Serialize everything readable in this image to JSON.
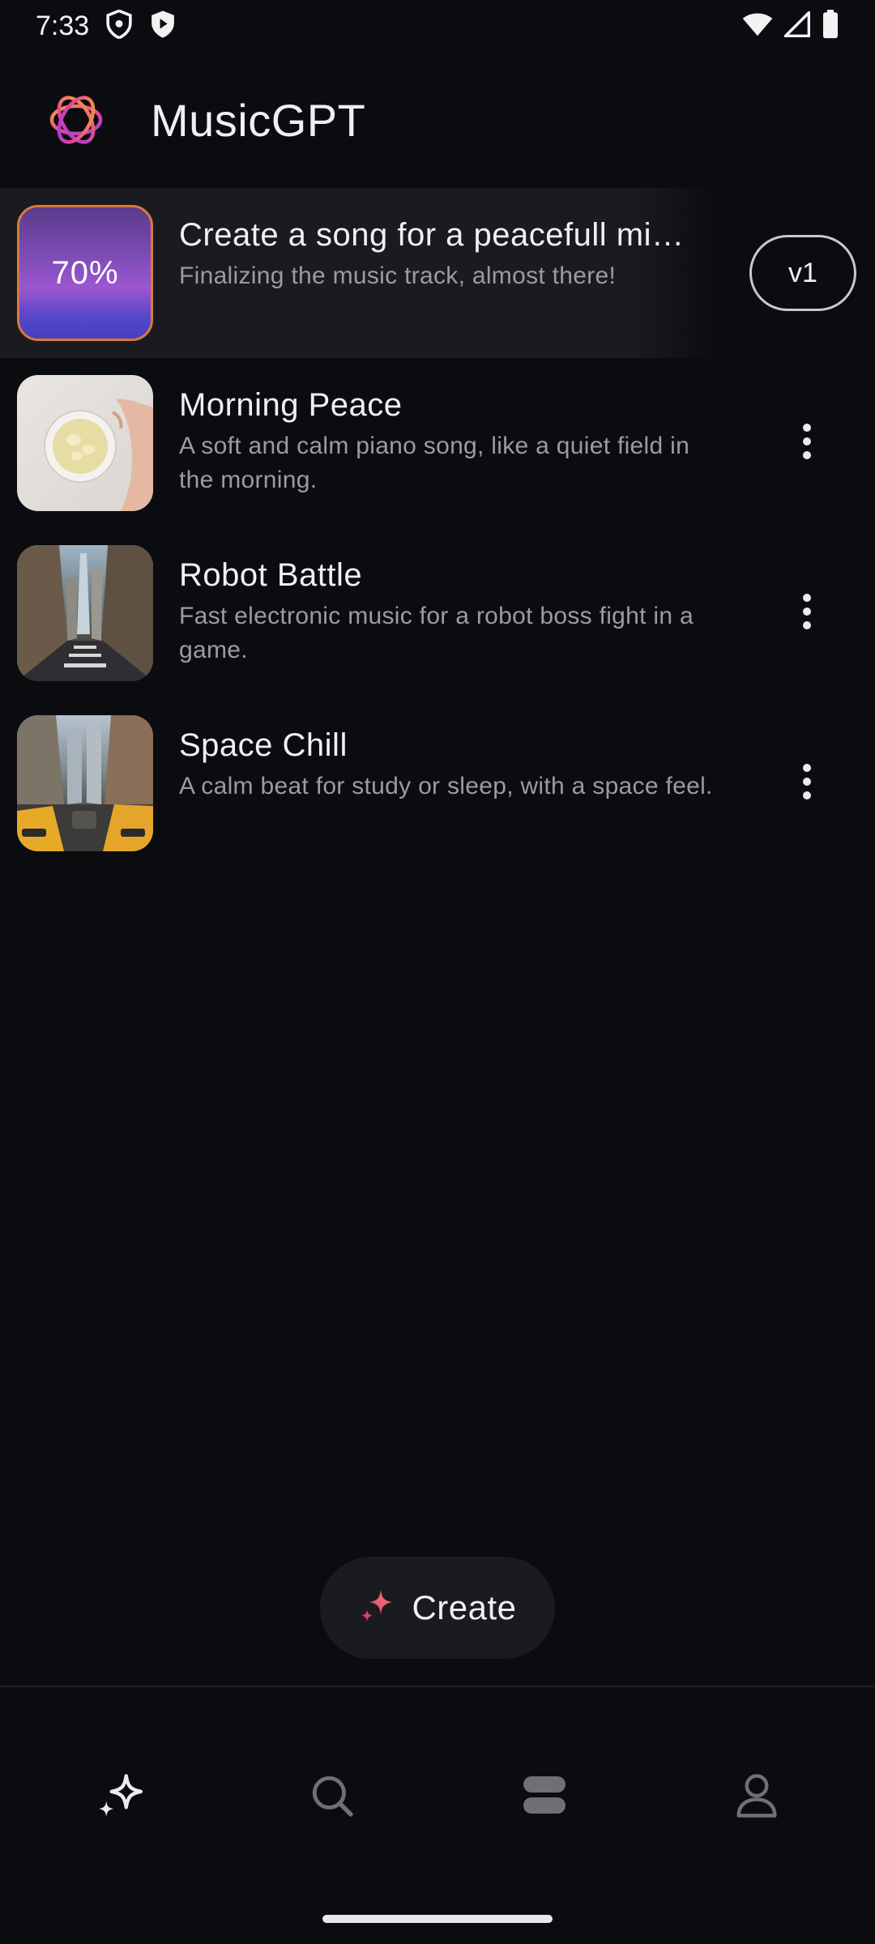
{
  "status_bar": {
    "time": "7:33"
  },
  "app": {
    "title": "MusicGPT"
  },
  "generating_item": {
    "progress_label": "70%",
    "progress_fraction": 0.7,
    "title": "Create a song for a peacefull mi…",
    "subtitle": "Finalizing the music track, almost there!",
    "version": "v1"
  },
  "songs": [
    {
      "title": "Morning Peace",
      "description": "A soft and calm piano song, like a quiet field in the morning."
    },
    {
      "title": "Robot Battle",
      "description": "Fast electronic music for a robot boss fight in a game."
    },
    {
      "title": "Space Chill",
      "description": "A calm beat for study or sleep, with a space feel."
    }
  ],
  "create_button": {
    "label": "Create"
  },
  "bottom_nav": {
    "items": [
      "create-tab",
      "search-tab",
      "library-tab",
      "profile-tab"
    ],
    "active": "create-tab"
  },
  "colors": {
    "background": "#0b0c0f",
    "accent_orange": "#f08a3c",
    "accent_pink": "#e14aa6",
    "accent_purple": "#8c3cf0"
  }
}
